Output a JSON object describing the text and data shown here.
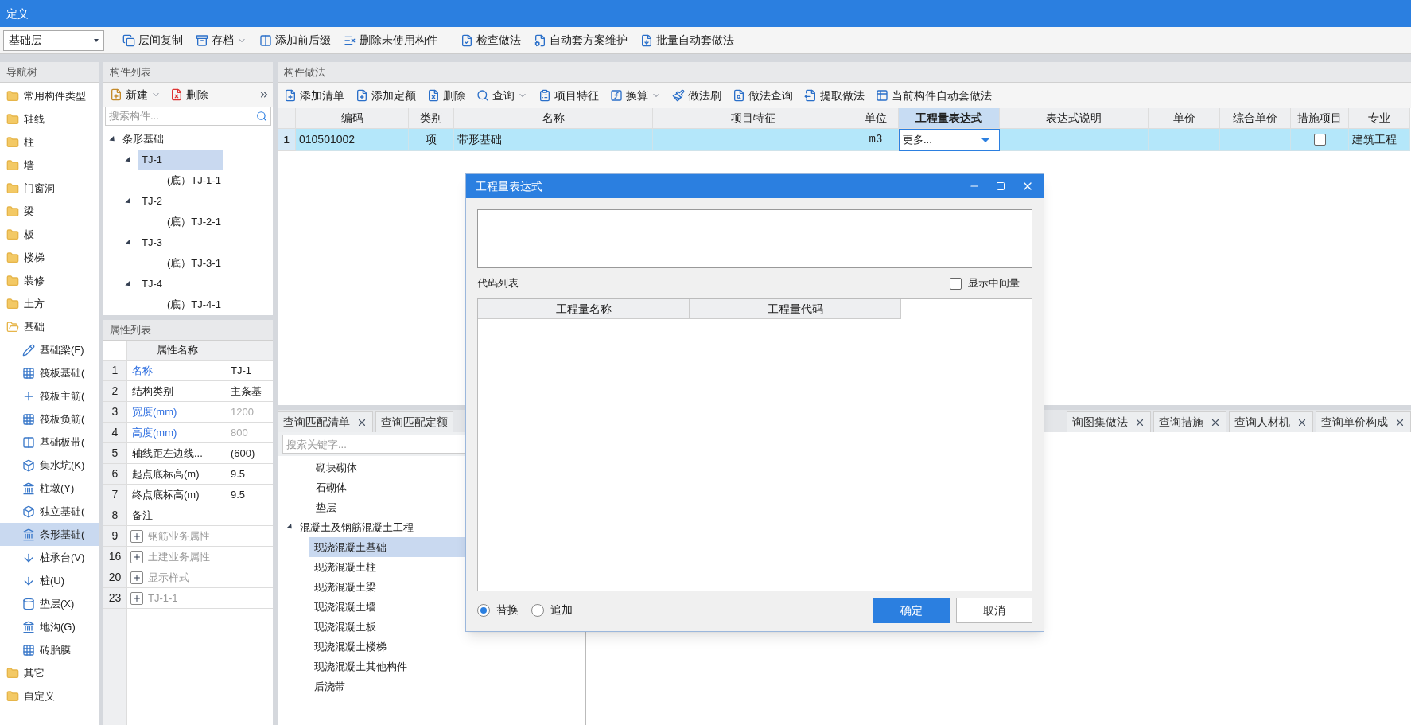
{
  "window": {
    "title": "定义"
  },
  "toolbar": {
    "level_select": "基础层",
    "groups": [
      [
        {
          "label": "层间复制",
          "dropdown": false
        },
        {
          "label": "存档",
          "dropdown": true
        },
        {
          "label": "添加前后缀",
          "dropdown": false
        },
        {
          "label": "删除未使用构件",
          "dropdown": false
        }
      ],
      [
        {
          "label": "检查做法",
          "dropdown": false
        },
        {
          "label": "自动套方案维护",
          "dropdown": false
        },
        {
          "label": "批量自动套做法",
          "dropdown": false
        }
      ]
    ]
  },
  "nav": {
    "title": "导航树",
    "items": [
      {
        "label": "常用构件类型",
        "expanded": false
      },
      {
        "label": "轴线",
        "expanded": false
      },
      {
        "label": "柱",
        "expanded": false
      },
      {
        "label": "墙",
        "expanded": false
      },
      {
        "label": "门窗洞",
        "expanded": false
      },
      {
        "label": "梁",
        "expanded": false
      },
      {
        "label": "板",
        "expanded": false
      },
      {
        "label": "楼梯",
        "expanded": false
      },
      {
        "label": "装修",
        "expanded": false
      },
      {
        "label": "土方",
        "expanded": false
      },
      {
        "label": "基础",
        "expanded": true,
        "children": [
          {
            "label": "基础梁(F)",
            "selected": false
          },
          {
            "label": "筏板基础(",
            "selected": false
          },
          {
            "label": "筏板主筋(",
            "selected": false
          },
          {
            "label": "筏板负筋(",
            "selected": false
          },
          {
            "label": "基础板带(",
            "selected": false
          },
          {
            "label": "集水坑(K)",
            "selected": false
          },
          {
            "label": "柱墩(Y)",
            "selected": false
          },
          {
            "label": "独立基础(",
            "selected": false
          },
          {
            "label": "条形基础(",
            "selected": true
          },
          {
            "label": "桩承台(V)",
            "selected": false
          },
          {
            "label": "桩(U)",
            "selected": false
          },
          {
            "label": "垫层(X)",
            "selected": false
          },
          {
            "label": "地沟(G)",
            "selected": false
          },
          {
            "label": "砖胎膜",
            "selected": false
          }
        ]
      },
      {
        "label": "其它",
        "expanded": false
      },
      {
        "label": "自定义",
        "expanded": false
      }
    ]
  },
  "component_list": {
    "title": "构件列表",
    "buttons": [
      {
        "label": "新建",
        "dropdown": true
      },
      {
        "label": "删除",
        "dropdown": false
      }
    ],
    "search": {
      "placeholder": "搜索构件..."
    },
    "tree": [
      {
        "label": "条形基础",
        "expanded": true,
        "selected": false,
        "children": [
          {
            "label": "TJ-1",
            "expanded": true,
            "selected": true,
            "children": [
              {
                "label": "(底）TJ-1-1",
                "selected": false
              }
            ]
          },
          {
            "label": "TJ-2",
            "expanded": true,
            "selected": false,
            "children": [
              {
                "label": "(底）TJ-2-1",
                "selected": false
              }
            ]
          },
          {
            "label": "TJ-3",
            "expanded": true,
            "selected": false,
            "children": [
              {
                "label": "(底）TJ-3-1",
                "selected": false
              }
            ]
          },
          {
            "label": "TJ-4",
            "expanded": true,
            "selected": false,
            "children": [
              {
                "label": "(底）TJ-4-1",
                "selected": false
              }
            ]
          }
        ]
      }
    ]
  },
  "properties": {
    "title": "属性列表",
    "header": "属性名称",
    "rows": [
      {
        "num": "1",
        "name": "名称",
        "value": "TJ-1",
        "kind": "field",
        "highlighted": true,
        "value_greyed": false
      },
      {
        "num": "2",
        "name": "结构类别",
        "value": "主条基",
        "kind": "field",
        "highlighted": false,
        "value_greyed": false
      },
      {
        "num": "3",
        "name": "宽度(mm)",
        "value": "1200",
        "kind": "field",
        "highlighted": true,
        "value_greyed": true
      },
      {
        "num": "4",
        "name": "高度(mm)",
        "value": "800",
        "kind": "field",
        "highlighted": true,
        "value_greyed": true
      },
      {
        "num": "5",
        "name": "轴线距左边线...",
        "value": "(600)",
        "kind": "field",
        "highlighted": false,
        "value_greyed": false
      },
      {
        "num": "6",
        "name": "起点底标高(m)",
        "value": "9.5",
        "kind": "field",
        "highlighted": false,
        "value_greyed": false
      },
      {
        "num": "7",
        "name": "终点底标高(m)",
        "value": "9.5",
        "kind": "field",
        "highlighted": false,
        "value_greyed": false
      },
      {
        "num": "8",
        "name": "备注",
        "kind": "field",
        "highlighted": false
      },
      {
        "num": "9",
        "name": "钢筋业务属性",
        "kind": "group"
      },
      {
        "num": "16",
        "name": "土建业务属性",
        "kind": "group"
      },
      {
        "num": "20",
        "name": "显示样式",
        "kind": "group"
      },
      {
        "num": "23",
        "name": "TJ-1-1",
        "kind": "group"
      }
    ]
  },
  "method": {
    "title": "构件做法",
    "toolbar": [
      {
        "label": "添加清单",
        "dropdown": false
      },
      {
        "label": "添加定额",
        "dropdown": false
      },
      {
        "label": "删除",
        "dropdown": false
      },
      {
        "label": "查询",
        "dropdown": true
      },
      {
        "label": "项目特征",
        "dropdown": false
      },
      {
        "label": "换算",
        "dropdown": true
      },
      {
        "label": "做法刷",
        "dropdown": false
      },
      {
        "label": "做法查询",
        "dropdown": false
      },
      {
        "label": "提取做法",
        "dropdown": false
      },
      {
        "label": "当前构件自动套做法",
        "dropdown": false
      }
    ],
    "table": {
      "columns": [
        {
          "label": "编码",
          "selected": false
        },
        {
          "label": "类别",
          "selected": false
        },
        {
          "label": "名称",
          "selected": false
        },
        {
          "label": "项目特征",
          "selected": false
        },
        {
          "label": "单位",
          "selected": false
        },
        {
          "label": "工程量表达式",
          "selected": true
        },
        {
          "label": "表达式说明",
          "selected": false
        },
        {
          "label": "单价",
          "selected": false
        },
        {
          "label": "综合单价",
          "selected": false
        },
        {
          "label": "措施项目",
          "selected": false
        },
        {
          "label": "专业",
          "selected": false
        }
      ],
      "rows": [
        {
          "num": "1",
          "selected": true,
          "code": "010501002",
          "type": "项",
          "name": "带形基础",
          "unit": "m3",
          "expression": "更多...",
          "measure": false,
          "discipline": "建筑工程"
        }
      ]
    }
  },
  "query_tabs": {
    "left": [
      {
        "label": "查询匹配清单",
        "closable": true
      },
      {
        "label": "查询匹配定额",
        "closable": false
      }
    ],
    "right": [
      {
        "label": "询图集做法",
        "closable": true
      },
      {
        "label": "查询措施",
        "closable": true
      },
      {
        "label": "查询人材机",
        "closable": true
      },
      {
        "label": "查询单价构成",
        "closable": true
      }
    ]
  },
  "query_search": {
    "placeholder": "搜索关键字..."
  },
  "query_tree": [
    {
      "label": "砌块砌体",
      "kind": "leaf",
      "selected": false
    },
    {
      "label": "石砌体",
      "kind": "leaf",
      "selected": false
    },
    {
      "label": "垫层",
      "kind": "leaf",
      "selected": false
    },
    {
      "label": "混凝土及钢筋混凝土工程",
      "kind": "group",
      "expanded": true,
      "children": [
        {
          "label": "现浇混凝土基础",
          "selected": true
        },
        {
          "label": "现浇混凝土柱",
          "selected": false
        },
        {
          "label": "现浇混凝土梁",
          "selected": false
        },
        {
          "label": "现浇混凝土墙",
          "selected": false
        },
        {
          "label": "现浇混凝土板",
          "selected": false
        },
        {
          "label": "现浇混凝土楼梯",
          "selected": false
        },
        {
          "label": "现浇混凝土其他构件",
          "selected": false
        },
        {
          "label": "后浇带",
          "selected": false
        }
      ]
    }
  ],
  "dialog": {
    "title": "工程量表达式",
    "code_list_label": "代码列表",
    "show_intermediate": {
      "label": "显示中间量",
      "checked": false
    },
    "columns": [
      "工程量名称",
      "工程量代码"
    ],
    "modes": [
      {
        "label": "替换",
        "selected": true
      },
      {
        "label": "追加",
        "selected": false
      }
    ],
    "buttons": [
      {
        "label": "确定",
        "primary": true
      },
      {
        "label": "取消",
        "primary": false
      }
    ]
  }
}
